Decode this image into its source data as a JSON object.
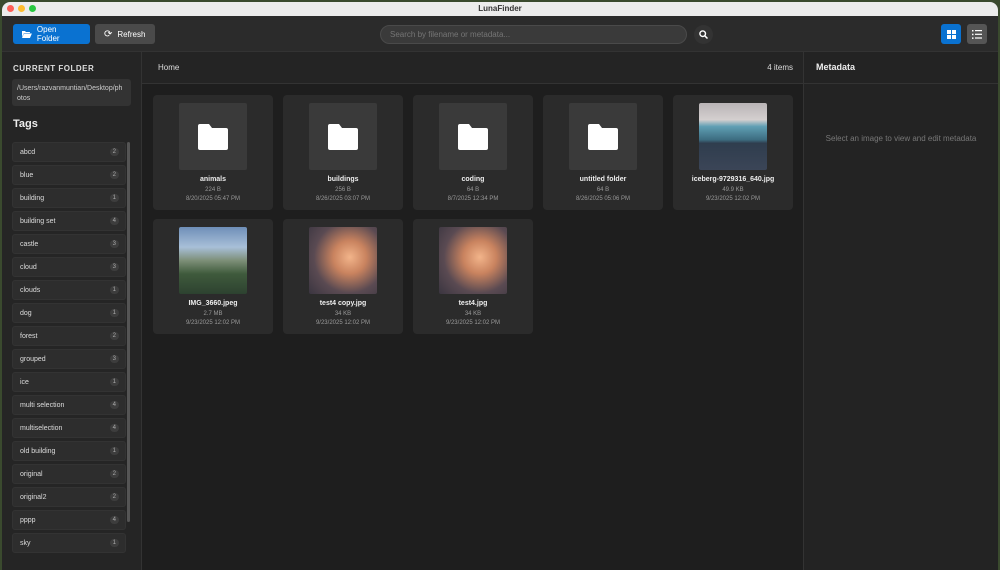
{
  "app": {
    "title": "LunaFinder"
  },
  "toolbar": {
    "open_folder": "Open Folder",
    "refresh": "Refresh",
    "search_placeholder": "Search by filename or metadata..."
  },
  "colors": {
    "accent": "#0a72d1"
  },
  "sidebar": {
    "current_folder_label": "CURRENT FOLDER",
    "path": "/Users/razvanmuntian/Desktop/photos",
    "tags_label": "Tags",
    "tags": [
      {
        "name": "abcd",
        "count": "2"
      },
      {
        "name": "blue",
        "count": "2"
      },
      {
        "name": "building",
        "count": "1"
      },
      {
        "name": "building set",
        "count": "4"
      },
      {
        "name": "castle",
        "count": "3"
      },
      {
        "name": "cloud",
        "count": "3"
      },
      {
        "name": "clouds",
        "count": "1"
      },
      {
        "name": "dog",
        "count": "1"
      },
      {
        "name": "forest",
        "count": "2"
      },
      {
        "name": "grouped",
        "count": "3"
      },
      {
        "name": "ice",
        "count": "1"
      },
      {
        "name": "multi selection",
        "count": "4"
      },
      {
        "name": "multiselection",
        "count": "4"
      },
      {
        "name": "old building",
        "count": "1"
      },
      {
        "name": "original",
        "count": "2"
      },
      {
        "name": "original2",
        "count": "2"
      },
      {
        "name": "pppp",
        "count": "4"
      },
      {
        "name": "sky",
        "count": "1"
      }
    ]
  },
  "main": {
    "breadcrumb": "Home",
    "item_count": "4 items",
    "items": [
      {
        "name": "animals",
        "size": "224 B",
        "date": "8/20/2025 05:47 PM",
        "type": "folder"
      },
      {
        "name": "buildings",
        "size": "256 B",
        "date": "8/26/2025 03:07 PM",
        "type": "folder"
      },
      {
        "name": "coding",
        "size": "64 B",
        "date": "8/7/2025 12:34 PM",
        "type": "folder"
      },
      {
        "name": "untitled folder",
        "size": "64 B",
        "date": "8/26/2025 05:06 PM",
        "type": "folder"
      },
      {
        "name": "iceberg-9729316_640.jpg",
        "size": "49.9 KB",
        "date": "9/23/2025 12:02 PM",
        "type": "iceberg"
      },
      {
        "name": "IMG_3660.jpeg",
        "size": "2.7 MB",
        "date": "9/23/2025 12:02 PM",
        "type": "aerial"
      },
      {
        "name": "test4 copy.jpg",
        "size": "34 KB",
        "date": "9/23/2025 12:02 PM",
        "type": "clouds"
      },
      {
        "name": "test4.jpg",
        "size": "34 KB",
        "date": "9/23/2025 12:02 PM",
        "type": "clouds"
      }
    ]
  },
  "metadata": {
    "title": "Metadata",
    "empty_message": "Select an image to view and edit metadata"
  }
}
